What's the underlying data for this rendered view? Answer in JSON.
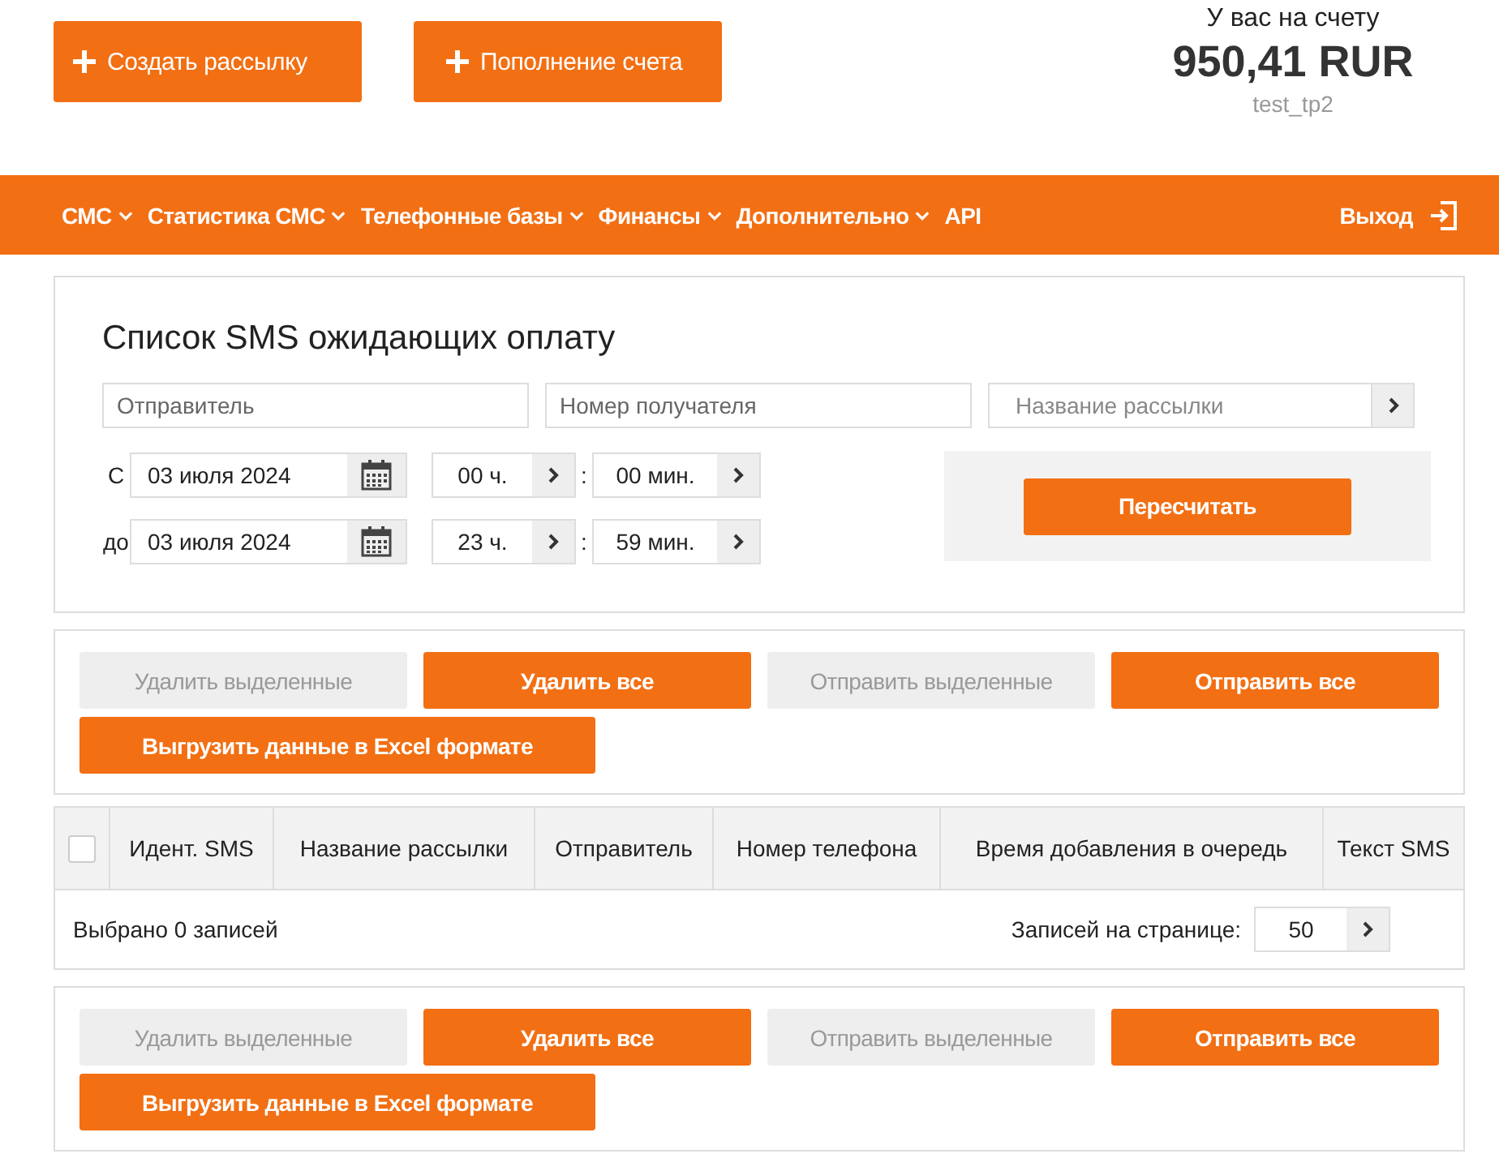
{
  "top_buttons": [
    {
      "label": "Создать рассылку"
    },
    {
      "label": "Пополнение счета"
    }
  ],
  "account": {
    "label": "У вас на счету",
    "balance": "950,41 RUR",
    "login": "test_tp2"
  },
  "nav": {
    "items": [
      {
        "label": "СМС",
        "dropdown": true
      },
      {
        "label": "Статистика СМС",
        "dropdown": true
      },
      {
        "label": "Телефонные базы",
        "dropdown": true
      },
      {
        "label": "Финансы",
        "dropdown": true
      },
      {
        "label": "Дополнительно",
        "dropdown": true
      },
      {
        "label": "API",
        "dropdown": false
      }
    ],
    "logout": "Выход"
  },
  "filter": {
    "title": "Список SMS ожидающих оплату",
    "fields": [
      {
        "placeholder": "Отправитель",
        "arrow": false
      },
      {
        "placeholder": "Номер получателя",
        "arrow": false
      },
      {
        "placeholder": "Название рассылки",
        "arrow": true
      }
    ],
    "ranges": [
      {
        "prefix": "С",
        "date": "03 июля 2024",
        "hour": "00 ч.",
        "minute": "00 мин."
      },
      {
        "prefix": "до",
        "date": "03 июля 2024",
        "hour": "23 ч.",
        "minute": "59 мин."
      }
    ],
    "separator": ":",
    "recalc": "Пересчитать"
  },
  "actions_top": [
    {
      "label": "Удалить выделенные",
      "disabled": true
    },
    {
      "label": "Удалить все",
      "disabled": false
    },
    {
      "label": "Отправить выделенные",
      "disabled": true
    },
    {
      "label": "Отправить все",
      "disabled": false
    },
    {
      "label": "Выгрузить данные в Excel формате",
      "disabled": false
    }
  ],
  "table": {
    "select_all": false,
    "columns": [
      "Идент. SMS",
      "Название рассылки",
      "Отправитель",
      "Номер телефона",
      "Время добавления в очередь",
      "Текст SMS"
    ],
    "selected_count": "Выбрано 0 записей",
    "per_page_label": "Записей на странице:",
    "per_page": "50"
  },
  "actions_bottom": [
    {
      "label": "Удалить выделенные",
      "disabled": true
    },
    {
      "label": "Удалить все",
      "disabled": false
    },
    {
      "label": "Отправить выделенные",
      "disabled": true
    },
    {
      "label": "Отправить все",
      "disabled": false
    },
    {
      "label": "Выгрузить данные в Excel формате",
      "disabled": false
    }
  ]
}
